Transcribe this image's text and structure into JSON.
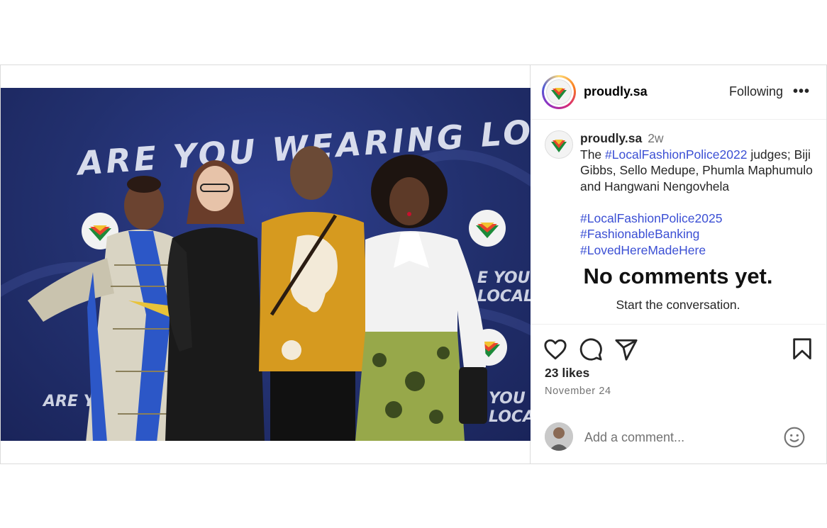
{
  "photo": {
    "slogan": "ARE YOU WEARING LOCAL?",
    "left_bottom_text": "ARE YOU WEARING",
    "right_mid_text": "E YOU LOCAL",
    "right_bottom_text": "YOU LOCAL"
  },
  "header": {
    "username": "proudly.sa",
    "follow_label": "Following",
    "more_label": "•••"
  },
  "caption": {
    "username": "proudly.sa",
    "time": "2w",
    "pre": "The ",
    "tag1": "#LocalFashionPolice2022",
    "body": " judges; Biji Gibbs, Sello Medupe, Phumla Maphumulo and Hangwani Nengovhela",
    "tags": [
      "#LocalFashionPolice2025",
      "#FashionableBanking",
      "#LovedHereMadeHere"
    ]
  },
  "comments": {
    "empty_title": "No comments yet.",
    "empty_sub": "Start the conversation."
  },
  "actions": {
    "icons": [
      "heart-icon",
      "comment-icon",
      "share-icon",
      "bookmark-icon"
    ],
    "likes": "23 likes",
    "date": "November 24"
  },
  "add_comment": {
    "placeholder": "Add a comment..."
  }
}
